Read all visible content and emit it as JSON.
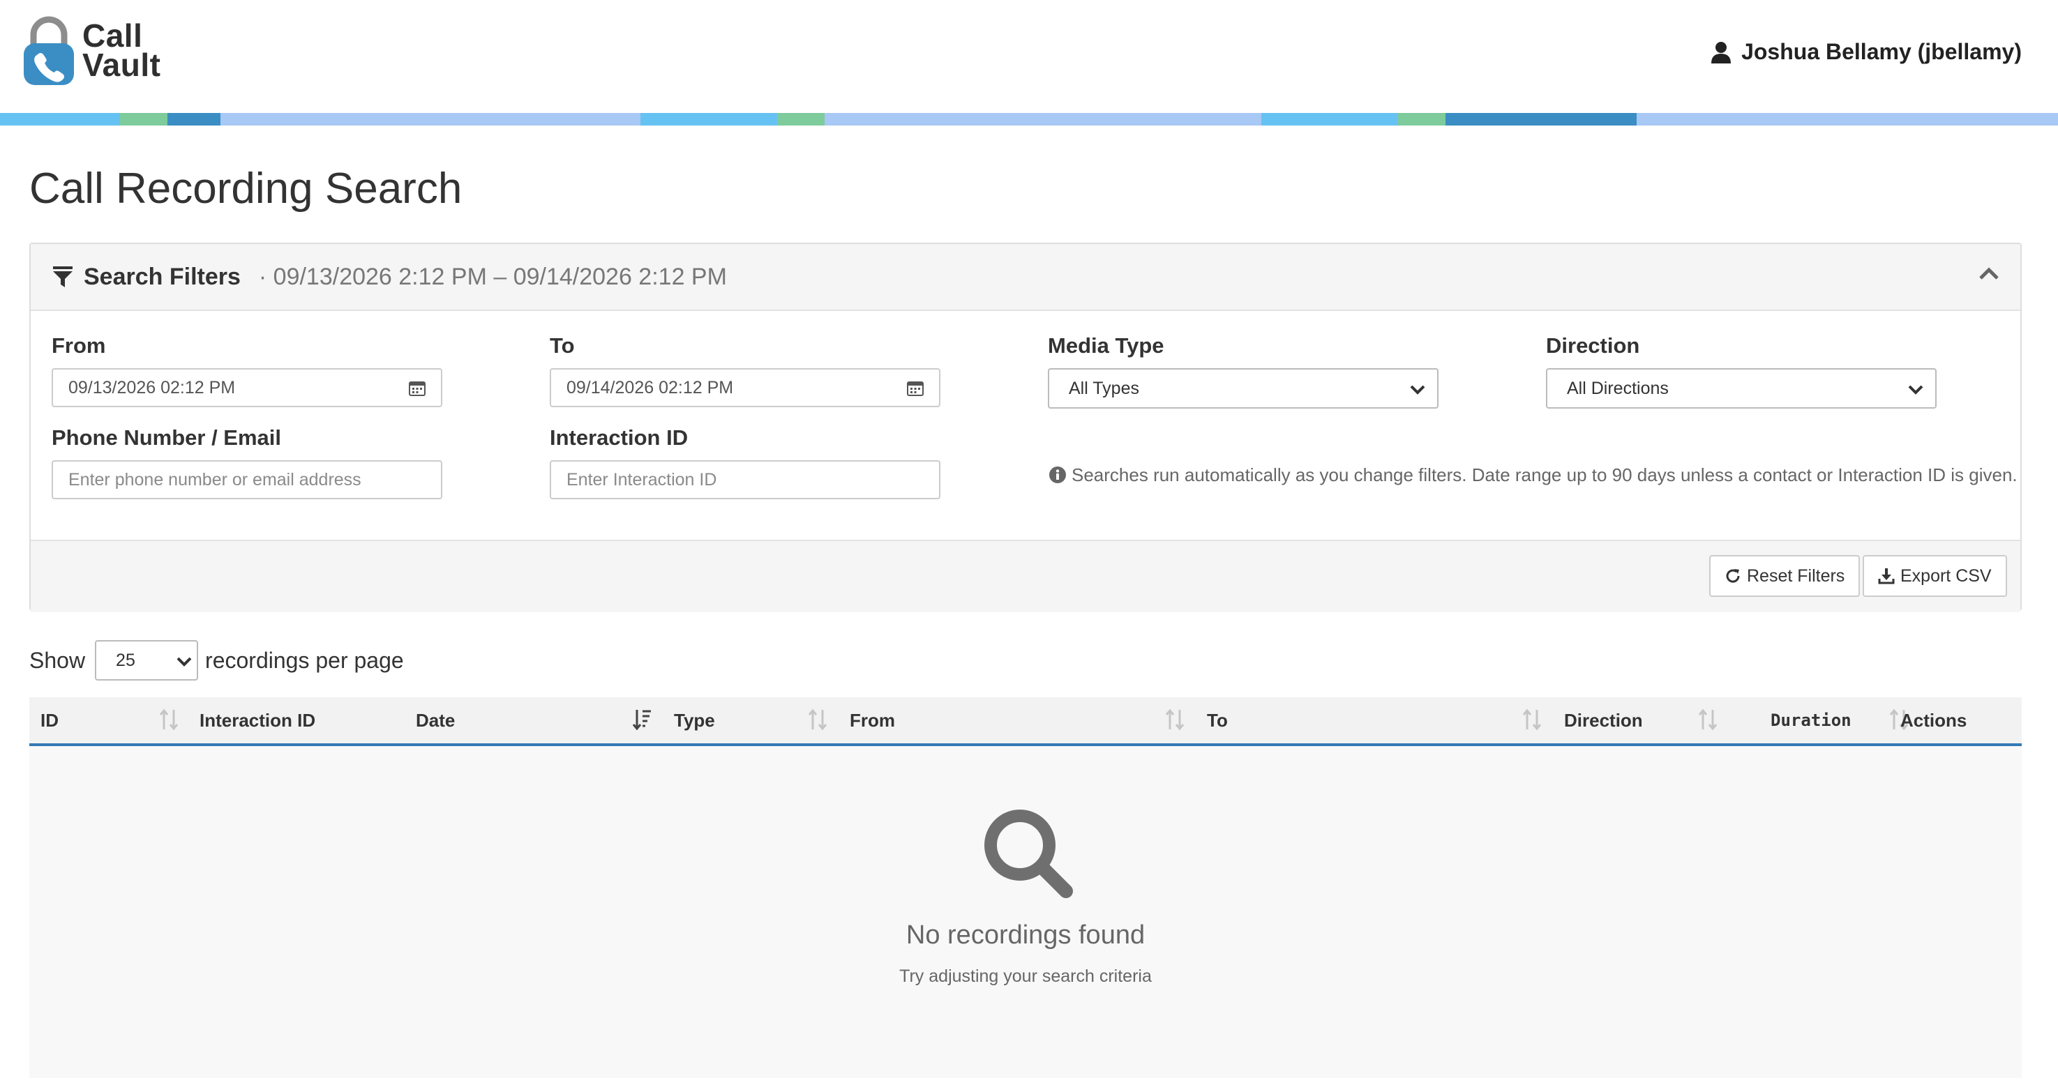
{
  "app": {
    "logo_line1": "Call",
    "logo_line2": "Vault",
    "user": "Joshua Bellamy (jbellamy)",
    "icons": [
      "lock-phone-logo-icon",
      "user-icon"
    ]
  },
  "colors": {
    "accent": "#337ab7",
    "stripe": [
      "#66c2f2",
      "#7ecb9c",
      "#3b8ec4",
      "#a8c8f5"
    ]
  },
  "page": {
    "title": "Call Recording Search"
  },
  "filters": {
    "header_title": "Search Filters",
    "header_range": "· 09/13/2026 2:12 PM – 09/14/2026 2:12 PM",
    "from_label": "From",
    "from_value": "09/13/2026 02:12 PM",
    "to_label": "To",
    "to_value": "09/14/2026 02:12 PM",
    "media_label": "Media Type",
    "media_value": "All Types",
    "direction_label": "Direction",
    "direction_value": "All Directions",
    "phone_label": "Phone Number / Email",
    "phone_placeholder": "Enter phone number or email address",
    "interaction_label": "Interaction ID",
    "interaction_placeholder": "Enter Interaction ID",
    "note": "Searches run automatically as you change filters. Date range up to 90 days unless a contact or Interaction ID is given.",
    "reset_label": "Reset Filters",
    "export_label": "Export CSV"
  },
  "pagination": {
    "show_label": "Show",
    "per_page_value": "25",
    "per_page_suffix": "recordings per page"
  },
  "table": {
    "columns": [
      "ID",
      "Interaction ID",
      "Date",
      "Type",
      "From",
      "To",
      "Direction",
      "Duration",
      "Actions"
    ]
  },
  "empty_state": {
    "title": "No recordings found",
    "subtitle": "Try adjusting your search criteria"
  }
}
